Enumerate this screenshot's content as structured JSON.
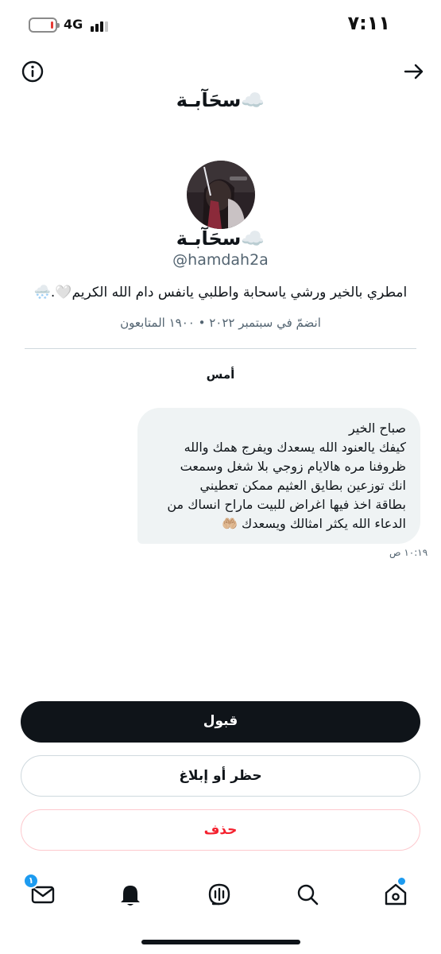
{
  "status_bar": {
    "network": "4G",
    "time": "٧:١١",
    "battery_level": 0.12,
    "battery_color": "#e53935"
  },
  "header": {
    "title": "سحَآبـة☁️",
    "info_icon": "info-icon",
    "back_icon": "arrow-right-icon"
  },
  "profile": {
    "name": "سحَآبـة☁️",
    "handle": "@hamdah2a",
    "bio": "امطري بالخير ورشي ياسحابة واطلبي يانفس دام الله الكريم🤍.🌨️",
    "meta": "انضمّ في سبتمبر ٢٠٢٢ • ١٩٠٠ المتابعون"
  },
  "conversation": {
    "day_label": "أمس",
    "message_lines": [
      "صباح الخير",
      "كيفك يالعنود الله يسعدك ويفرج همك والله",
      "ظروفنا مره هالايام زوجي بلا شغل وسمعت",
      "انك توزعين بطايق العثيم ممكن تعطيني",
      "بطاقة اخذ فيها اغراض للبيت ماراح انساك من",
      "الدعاء الله يكثر امثالك ويسعدك 🤲🏼"
    ],
    "time": "١٠:١٩ ص"
  },
  "actions": {
    "accept_label": "قبول",
    "block_label": "حظر أو إبلاغ",
    "delete_label": "حذف"
  },
  "tab_bar": {
    "messages_icon": "mail-icon",
    "messages_badge": "١",
    "notifications_icon": "bell-icon",
    "spaces_icon": "spaces-icon",
    "search_icon": "search-icon",
    "home_icon": "home-icon"
  },
  "colors": {
    "accent": "#1d9bf0",
    "delete": "#f4212e",
    "bubble": "#eff3f4",
    "primary": "#0f1419"
  }
}
